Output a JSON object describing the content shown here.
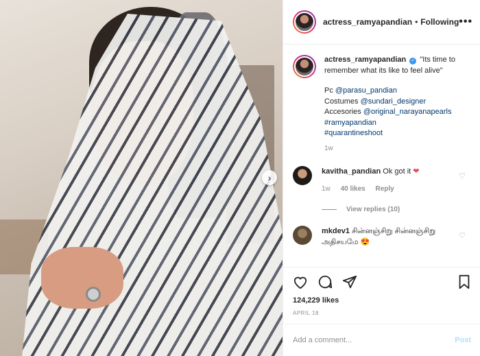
{
  "header": {
    "username": "actress_ramyapandian",
    "separator": "•",
    "follow_status": "Following",
    "more": "•••"
  },
  "photo": {
    "next_glyph": "›"
  },
  "caption": {
    "username": "actress_ramyapandian",
    "verified_glyph": "✓",
    "text": "\"Its time to remember what its like to feel alive\"",
    "pc_label": "Pc",
    "pc_link": "@parasu_pandian",
    "costumes_label": "Costumes",
    "costumes_link": "@sundari_designer",
    "accesories_label": "Accesories",
    "accesories_link": "@original_narayanapearls",
    "hashtag1": "#ramyapandian",
    "hashtag2": "#quarantineshoot",
    "time": "1w"
  },
  "comments": [
    {
      "username": "kavitha_pandian",
      "text": "Ok got it",
      "emoji": "❤",
      "time": "1w",
      "likes": "40 likes",
      "reply": "Reply",
      "view_replies": "View replies (10)"
    },
    {
      "username": "mkdev1",
      "text": "சின்னஞ்சிறு சின்னஞ்சிறு அதிசயமே",
      "emoji": "😍"
    }
  ],
  "actions": {
    "likes": "124,229 likes",
    "date": "APRIL 18"
  },
  "add_comment": {
    "placeholder": "Add a comment...",
    "post": "Post"
  },
  "icons": [
    "heart-icon",
    "comment-icon",
    "share-icon",
    "bookmark-icon",
    "more-icon",
    "chevron-right-icon",
    "verified-icon"
  ]
}
